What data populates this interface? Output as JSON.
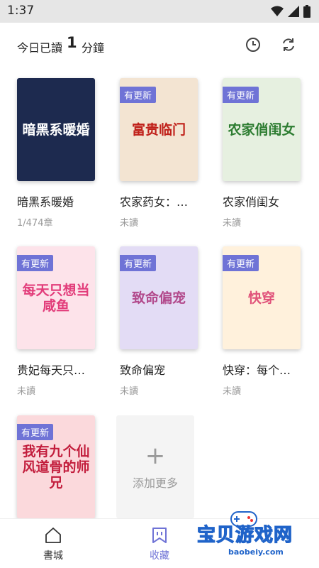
{
  "status": {
    "time": "1:37"
  },
  "header": {
    "read_label": "今日已讀",
    "read_count": "1",
    "read_unit": "分鐘"
  },
  "badge_label": "有更新",
  "books": [
    {
      "title": "暗黑系暖婚",
      "sub": "1/474章",
      "cover_title": "暗黑系暖婚",
      "badge": false,
      "bg": "#1d2a4f",
      "fg": "#ffffff"
    },
    {
      "title": "农家药女：…",
      "sub": "未讀",
      "cover_title": "富贵临门",
      "badge": true,
      "bg": "#f3e4d2",
      "fg": "#c0201a"
    },
    {
      "title": "农家俏闺女",
      "sub": "未讀",
      "cover_title": "农家俏闺女",
      "badge": true,
      "bg": "#e6f0e0",
      "fg": "#2e7d32"
    },
    {
      "title": "贵妃每天只…",
      "sub": "未讀",
      "cover_title": "每天只想当咸鱼",
      "badge": true,
      "bg": "#fde3ea",
      "fg": "#e23c7a"
    },
    {
      "title": "致命偏宠",
      "sub": "未讀",
      "cover_title": "致命偏宠",
      "badge": true,
      "bg": "#e3dcf5",
      "fg": "#b24a8c"
    },
    {
      "title": "快穿：每个…",
      "sub": "未讀",
      "cover_title": "快穿",
      "badge": true,
      "bg": "#fff1dc",
      "fg": "#e0527a"
    },
    {
      "title": "",
      "sub": "",
      "cover_title": "我有九个仙风道骨的师兄",
      "badge": true,
      "bg": "#fbd9dc",
      "fg": "#c21d3c"
    }
  ],
  "add_more_label": "添加更多",
  "nav": [
    {
      "label": "書城",
      "active": false
    },
    {
      "label": "收藏",
      "active": true
    }
  ],
  "colors": {
    "accent": "#6f73d6",
    "muted": "#999999"
  },
  "watermark": {
    "title": "宝贝游戏网",
    "url": "baobeiy.com"
  }
}
